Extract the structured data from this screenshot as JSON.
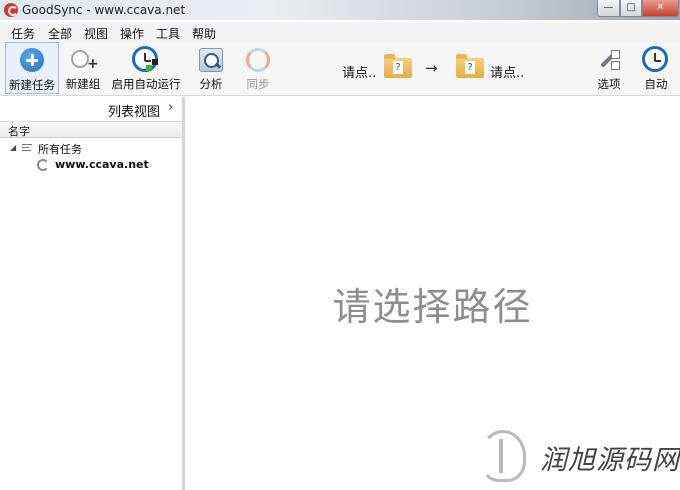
{
  "window": {
    "title": "GoodSync - www.ccava.net",
    "close_label": "✕",
    "min_label": "—",
    "max_label": "□"
  },
  "menu": [
    "任务",
    "全部",
    "视图",
    "操作",
    "工具",
    "帮助"
  ],
  "toolbar": {
    "new_job": "新建任务",
    "new_group": "新建组",
    "enable_auto": "启用自动运行",
    "analyze": "分析",
    "sync": "同步",
    "left_path": "请点..",
    "right_path": "请点..",
    "folder_mark": "?",
    "arrow": "→",
    "options": "选项",
    "auto": "自动"
  },
  "left_panel": {
    "view_mode": "列表视图",
    "view_mode_chevron": "›",
    "column_name": "名字",
    "tree_expander": "◢",
    "root": "所有任务",
    "job": "www.ccava.net"
  },
  "main": {
    "placeholder": "请选择路径"
  },
  "watermark": {
    "text": "润旭源码网"
  }
}
